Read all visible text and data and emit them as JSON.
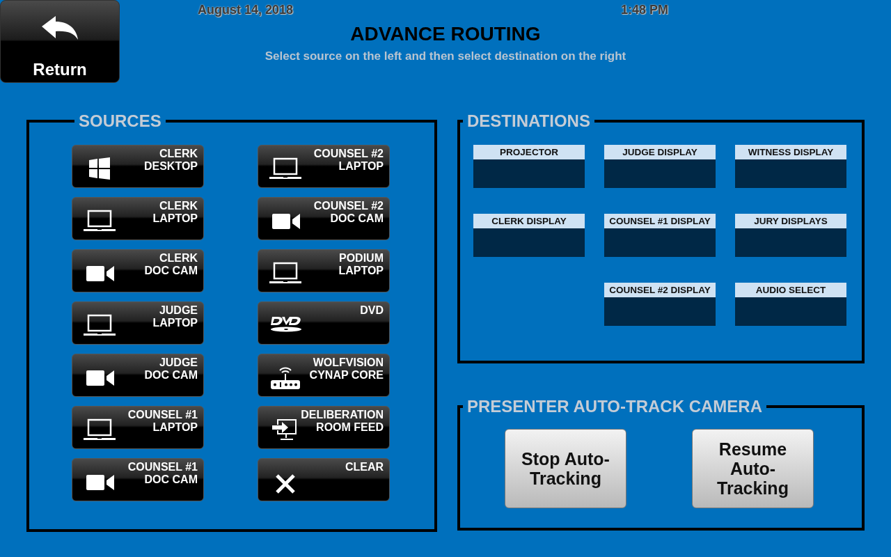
{
  "header": {
    "return_button": "Return",
    "date": "August 14, 2018",
    "time": "1:48 PM",
    "title": "ADVANCE ROUTING",
    "subtitle": "Select source on the left and then select destination on the right"
  },
  "sources": {
    "title": "SOURCES",
    "columns": [
      [
        {
          "kind": "windows",
          "lines": [
            "CLERK",
            "DESKTOP"
          ]
        },
        {
          "kind": "laptop",
          "lines": [
            "CLERK",
            "LAPTOP"
          ]
        },
        {
          "kind": "camera",
          "lines": [
            "CLERK",
            "DOC CAM"
          ]
        },
        {
          "kind": "laptop",
          "lines": [
            "JUDGE",
            "LAPTOP"
          ]
        },
        {
          "kind": "camera",
          "lines": [
            "JUDGE",
            "DOC CAM"
          ]
        },
        {
          "kind": "laptop",
          "lines": [
            "COUNSEL #1",
            "LAPTOP"
          ]
        },
        {
          "kind": "camera",
          "lines": [
            "COUNSEL #1",
            "DOC CAM"
          ]
        }
      ],
      [
        {
          "kind": "laptop",
          "lines": [
            "COUNSEL #2",
            "LAPTOP"
          ]
        },
        {
          "kind": "camera",
          "lines": [
            "COUNSEL #2",
            "DOC CAM"
          ]
        },
        {
          "kind": "laptop",
          "lines": [
            "PODIUM",
            "LAPTOP"
          ]
        },
        {
          "kind": "dvd",
          "lines": [
            "DVD"
          ]
        },
        {
          "kind": "router",
          "lines": [
            "WOLFVISION",
            "CYNAP CORE"
          ]
        },
        {
          "kind": "screen",
          "lines": [
            "DELIBERATION",
            "ROOM FEED"
          ]
        },
        {
          "kind": "clear",
          "lines": [
            "CLEAR"
          ]
        }
      ]
    ]
  },
  "destinations": {
    "title": "DESTINATIONS",
    "rows": [
      [
        "PROJECTOR",
        "JUDGE DISPLAY",
        "WITNESS DISPLAY"
      ],
      [
        "CLERK DISPLAY",
        "COUNSEL #1 DISPLAY",
        "JURY DISPLAYS"
      ],
      [
        "",
        "COUNSEL #2 DISPLAY",
        "AUDIO SELECT"
      ]
    ]
  },
  "camera": {
    "title": "PRESENTER AUTO-TRACK CAMERA",
    "buttons": [
      "Stop Auto-Tracking",
      "Resume Auto-Tracking"
    ]
  }
}
